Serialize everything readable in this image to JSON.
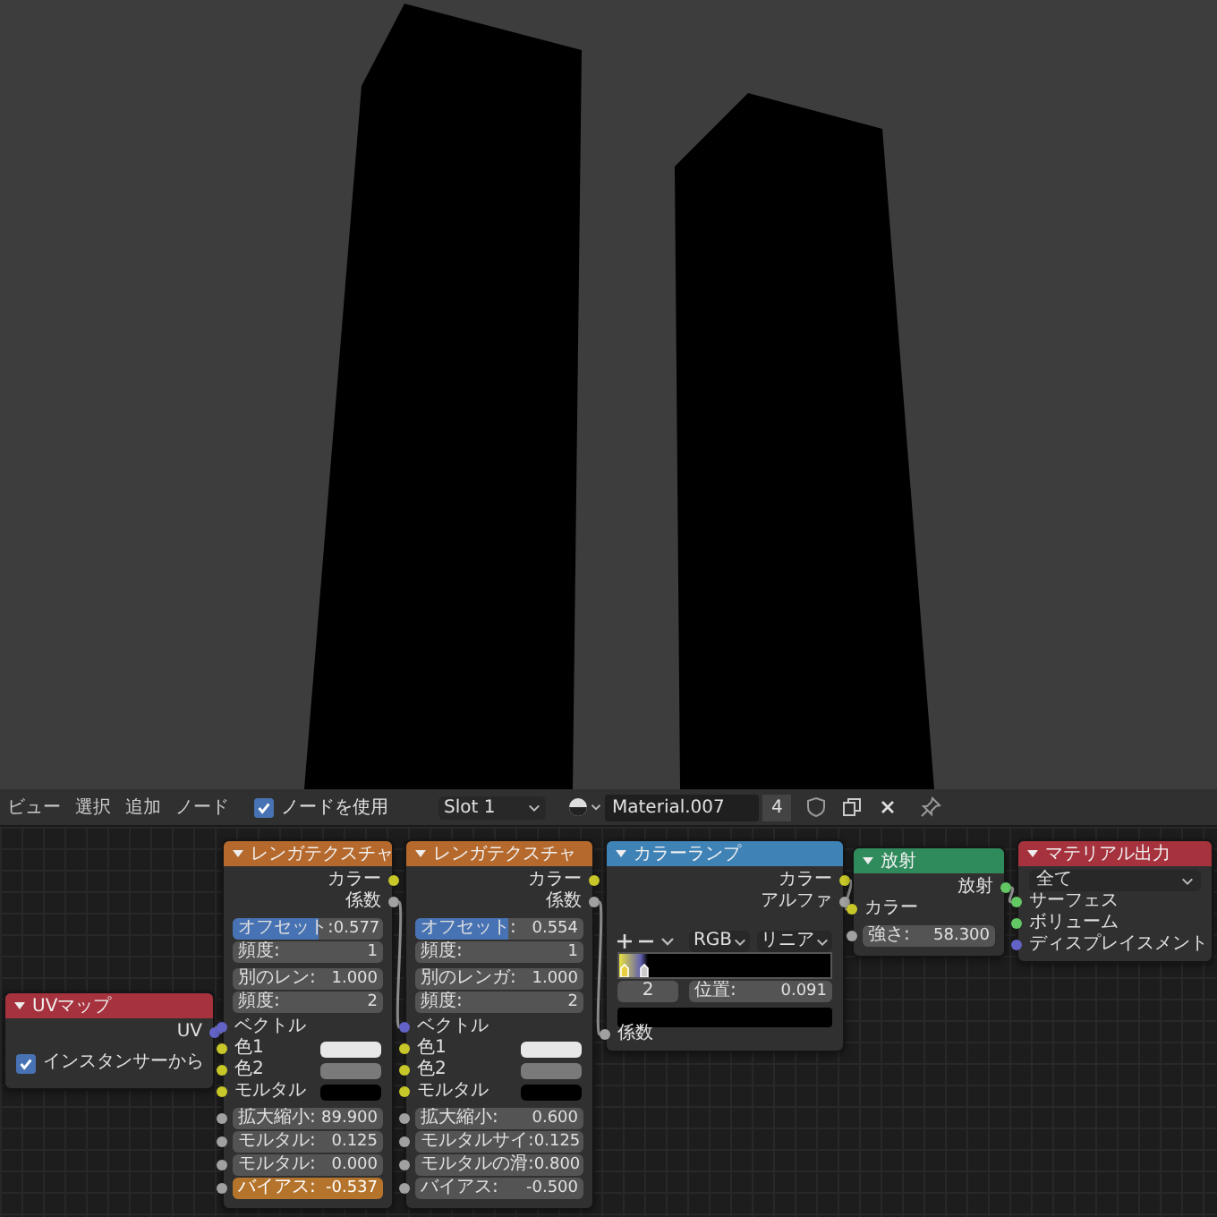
{
  "header": {
    "menus": [
      "ビュー",
      "選択",
      "追加",
      "ノード"
    ],
    "use_nodes": {
      "label": "ノードを使用",
      "checked": true
    },
    "slot": "Slot 1",
    "material": "Material.007",
    "users": "4"
  },
  "nodes": [
    {
      "title": "UVマップ",
      "color": "#a6323d",
      "rows": [
        {
          "kind": "output",
          "label": "UV",
          "socket": {
            "color": "#6363c7"
          }
        },
        {
          "kind": "checkbox",
          "label": "インスタンサーから",
          "checked": true
        }
      ]
    },
    {
      "title": "レンガテクスチャ",
      "color": "#b5692c",
      "rows": [
        {
          "kind": "output",
          "label": "カラー",
          "socket": {
            "color": "#c7c729"
          }
        },
        {
          "kind": "output",
          "label": "係数",
          "socket": {
            "color": "#a1a1a1"
          }
        },
        {
          "kind": "fields",
          "fields": [
            {
              "label": "オフセット:",
              "value": "0.577",
              "level": 0.577,
              "keyed": false
            },
            {
              "label": "頻度:",
              "value": "1",
              "keyed": false
            }
          ]
        },
        {
          "kind": "fields",
          "fields": [
            {
              "label": "別のレン:",
              "value": "1.000",
              "keyed": false
            },
            {
              "label": "頻度:",
              "value": "2",
              "keyed": false
            }
          ]
        },
        {
          "kind": "input",
          "label": "ベクトル",
          "socket": {
            "color": "#6363c7"
          }
        },
        {
          "kind": "color",
          "label": "色1",
          "socket": {
            "color": "#c7c729"
          },
          "color": "#e8e8e8"
        },
        {
          "kind": "color",
          "label": "色2",
          "socket": {
            "color": "#c7c729"
          },
          "color": "#7a7a7a"
        },
        {
          "kind": "color",
          "label": "モルタル",
          "socket": {
            "color": "#c7c729"
          },
          "color": "#000000"
        },
        {
          "kind": "fields",
          "fields": [
            {
              "label": "拡大縮小:",
              "value": "89.900",
              "socket": {
                "color": "#a1a1a1"
              },
              "keyed": false
            },
            {
              "label": "モルタル:",
              "value": "0.125",
              "socket": {
                "color": "#a1a1a1"
              },
              "keyed": false
            },
            {
              "label": "モルタル:",
              "value": "0.000",
              "socket": {
                "color": "#a1a1a1"
              },
              "keyed": false
            },
            {
              "label": "バイアス:",
              "value": "-0.537",
              "socket": {
                "color": "#a1a1a1"
              },
              "keyed": true
            }
          ]
        }
      ]
    },
    {
      "title": "レンガテクスチャ",
      "color": "#b5692c",
      "rows": [
        {
          "kind": "output",
          "label": "カラー",
          "socket": {
            "color": "#c7c729"
          }
        },
        {
          "kind": "output",
          "label": "係数",
          "socket": {
            "color": "#a1a1a1"
          }
        },
        {
          "kind": "fields",
          "fields": [
            {
              "label": "オフセット:",
              "value": "0.554",
              "level": 0.554,
              "keyed": false
            },
            {
              "label": "頻度:",
              "value": "1",
              "keyed": false
            }
          ]
        },
        {
          "kind": "fields",
          "fields": [
            {
              "label": "別のレンガ:",
              "value": "1.000",
              "keyed": false
            },
            {
              "label": "頻度:",
              "value": "2",
              "keyed": false
            }
          ]
        },
        {
          "kind": "input",
          "label": "ベクトル",
          "socket": {
            "color": "#6363c7"
          }
        },
        {
          "kind": "color",
          "label": "色1",
          "socket": {
            "color": "#c7c729"
          },
          "color": "#e8e8e8"
        },
        {
          "kind": "color",
          "label": "色2",
          "socket": {
            "color": "#c7c729"
          },
          "color": "#7a7a7a"
        },
        {
          "kind": "color",
          "label": "モルタル",
          "socket": {
            "color": "#c7c729"
          },
          "color": "#000000"
        },
        {
          "kind": "fields",
          "fields": [
            {
              "label": "拡大縮小:",
              "value": "0.600",
              "socket": {
                "color": "#a1a1a1"
              },
              "keyed": false
            },
            {
              "label": "モルタルサイ:",
              "value": "0.125",
              "socket": {
                "color": "#a1a1a1"
              },
              "keyed": false
            },
            {
              "label": "モルタルの滑:",
              "value": "0.800",
              "socket": {
                "color": "#a1a1a1"
              },
              "keyed": false
            },
            {
              "label": "バイアス:",
              "value": "-0.500",
              "socket": {
                "color": "#a1a1a1"
              },
              "keyed": false
            }
          ]
        }
      ]
    },
    {
      "title": "カラーランプ",
      "color": "#3f82b6",
      "rows": [
        {
          "kind": "output",
          "label": "カラー",
          "socket": {
            "color": "#c7c729"
          }
        },
        {
          "kind": "output",
          "label": "アルファ",
          "socket": {
            "color": "#a1a1a1"
          }
        },
        {
          "kind": "ramp_controls",
          "mode": "RGB",
          "interpolation": "リニア"
        },
        {
          "kind": "ramp"
        },
        {
          "kind": "ramp_fields",
          "index": "2",
          "label": "位置:",
          "value": "0.091"
        },
        {
          "kind": "color_bar",
          "color": "#000000"
        },
        {
          "kind": "input",
          "label": "係数",
          "socket": {
            "color": "#a1a1a1"
          }
        }
      ]
    },
    {
      "title": "放射",
      "color": "#2f8a5c",
      "rows": [
        {
          "kind": "output",
          "label": "放射",
          "socket": {
            "color": "#63c763"
          }
        },
        {
          "kind": "input",
          "label": "カラー",
          "socket": {
            "color": "#c7c729"
          }
        },
        {
          "kind": "fields",
          "fields": [
            {
              "label": "強さ:",
              "value": "58.300",
              "socket": {
                "color": "#a1a1a1"
              },
              "keyed": false
            }
          ]
        }
      ]
    },
    {
      "title": "マテリアル出力",
      "color": "#a6323d",
      "rows": [
        {
          "kind": "dropdown",
          "value": "全て"
        },
        {
          "kind": "input",
          "label": "サーフェス",
          "socket": {
            "color": "#63c763"
          }
        },
        {
          "kind": "input",
          "label": "ボリューム",
          "socket": {
            "color": "#63c763"
          }
        },
        {
          "kind": "input",
          "label": "ディスプレイスメント",
          "socket": {
            "color": "#6363c7"
          }
        }
      ]
    }
  ]
}
